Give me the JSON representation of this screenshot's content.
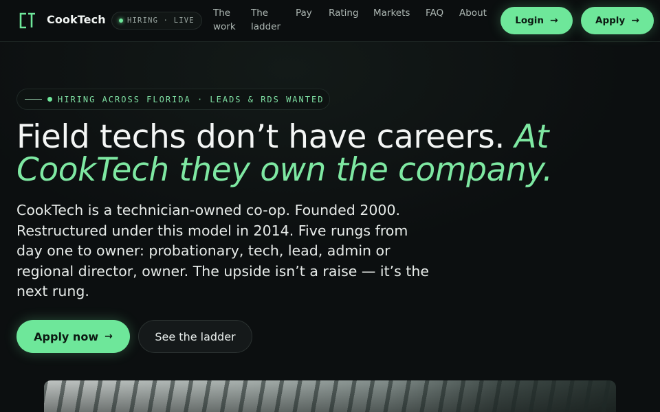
{
  "brand": {
    "name": "CookTech",
    "logo_icon": "ct-monogram-icon"
  },
  "status": {
    "text": "HIRING · LIVE"
  },
  "nav": {
    "links": [
      {
        "line1": "The",
        "line2": "work"
      },
      {
        "line1": "The",
        "line2": "ladder"
      },
      {
        "line1": "Pay",
        "line2": ""
      },
      {
        "line1": "Rating",
        "line2": ""
      },
      {
        "line1": "Markets",
        "line2": ""
      },
      {
        "line1": "FAQ",
        "line2": ""
      },
      {
        "line1": "About",
        "line2": ""
      }
    ],
    "login_label": "Login",
    "apply_label": "Apply",
    "arrow": "→"
  },
  "hero": {
    "kicker": "HIRING ACROSS FLORIDA · LEADS & RDS WANTED",
    "headline_plain": "Field techs don’t have careers. ",
    "headline_accent": "At CookTech they own the company.",
    "lede": "CookTech is a technician-owned co-op. Founded 2000. Restructured under this model in 2014. Five rungs from day one to owner: probationary, tech, lead, admin or regional director, owner. The upside isn’t a raise — it’s the next rung.",
    "cta_primary": "Apply now",
    "cta_secondary": "See the ladder",
    "arrow": "→"
  },
  "colors": {
    "accent": "#6ee79a",
    "background": "#0c0f10"
  }
}
